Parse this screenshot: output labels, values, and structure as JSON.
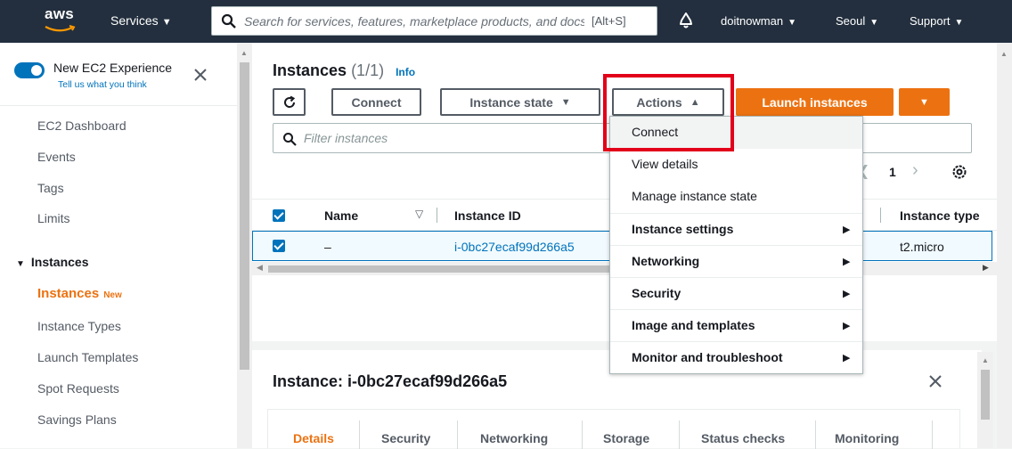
{
  "topnav": {
    "logo": "aws",
    "services": "Services",
    "search_placeholder": "Search for services, features, marketplace products, and docs",
    "search_shortcut": "[Alt+S]",
    "user": "doitnowman",
    "region": "Seoul",
    "support": "Support"
  },
  "sidebar": {
    "new_experience": "New EC2 Experience",
    "feedback_link": "Tell us what you think",
    "items": [
      "EC2 Dashboard",
      "Events",
      "Tags",
      "Limits"
    ],
    "section": "Instances",
    "active_item": "Instances",
    "new_badge": "New",
    "sub_items": [
      "Instance Types",
      "Launch Templates",
      "Spot Requests",
      "Savings Plans"
    ]
  },
  "instances_panel": {
    "title": "Instances",
    "count": "(1/1)",
    "info": "Info",
    "buttons": {
      "connect": "Connect",
      "instance_state": "Instance state",
      "actions": "Actions",
      "launch": "Launch instances"
    },
    "filter_placeholder": "Filter instances",
    "page": "1",
    "columns": [
      "Name",
      "Instance ID",
      "Instance type"
    ],
    "rows": [
      {
        "name": "–",
        "instance_id": "i-0bc27ecaf99d266a5",
        "instance_type": "t2.micro"
      }
    ]
  },
  "actions_menu": {
    "items": [
      {
        "label": "Connect"
      },
      {
        "label": "View details"
      },
      {
        "label": "Manage instance state"
      },
      {
        "label": "Instance settings"
      },
      {
        "label": "Networking"
      },
      {
        "label": "Security"
      },
      {
        "label": "Image and templates"
      },
      {
        "label": "Monitor and troubleshoot"
      }
    ]
  },
  "detail_panel": {
    "title": "Instance: i-0bc27ecaf99d266a5",
    "tabs": [
      "Details",
      "Security",
      "Networking",
      "Storage",
      "Status checks",
      "Monitoring"
    ]
  },
  "colors": {
    "nav_bg": "#232f3e",
    "accent_orange": "#ec7211",
    "link_blue": "#0073bb",
    "highlight_red": "#e2001a"
  }
}
